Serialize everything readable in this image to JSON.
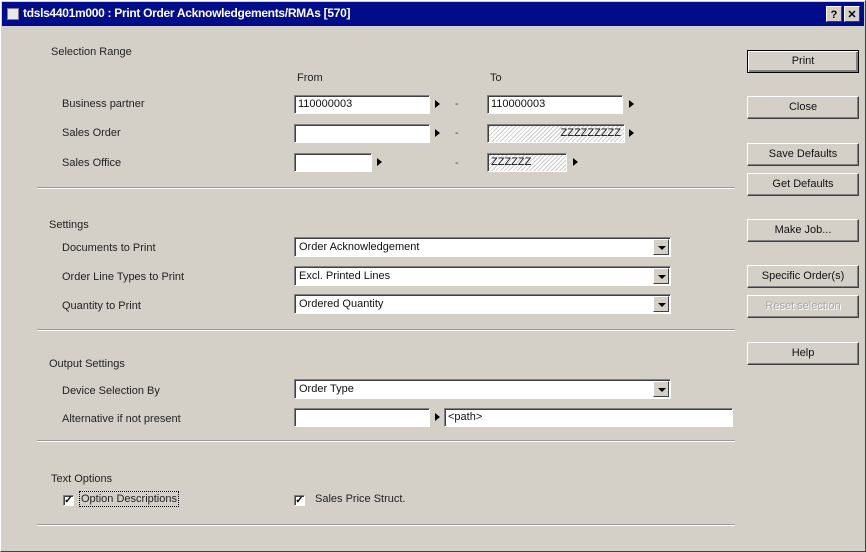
{
  "window": {
    "title": "tdsls4401m000 : Print Order Acknowledgements/RMAs [570]",
    "help_button": "?",
    "close_button": "✕"
  },
  "selection_range": {
    "title": "Selection Range",
    "from_label": "From",
    "to_label": "To",
    "rows": [
      {
        "label": "Business partner",
        "from_value": "110000003",
        "to_value": "110000003"
      },
      {
        "label": "Sales Order",
        "from_value": "",
        "to_value": "ZZZZZZZZZ"
      },
      {
        "label": "Sales Office",
        "from_value": "",
        "to_value": "ZZZZZZ"
      }
    ],
    "dash": "-"
  },
  "settings": {
    "title": "Settings",
    "documents_label": "Documents to Print",
    "documents_value": "Order Acknowledgement",
    "line_types_label": "Order Line Types to Print",
    "line_types_value": "Excl. Printed Lines",
    "quantity_label": "Quantity to Print",
    "quantity_value": "Ordered Quantity"
  },
  "output": {
    "title": "Output Settings",
    "device_label": "Device Selection By",
    "device_value": "Order Type",
    "alternative_label": "Alternative if not present",
    "alternative_value": "",
    "path_value": "<path>"
  },
  "text_options": {
    "title": "Text Options",
    "option_descriptions_label": "Option Descriptions",
    "option_descriptions_checked": true,
    "sales_price_label": "Sales Price Struct.",
    "sales_price_checked": true,
    "check_mark": "✓"
  },
  "buttons": {
    "print": "Print",
    "close": "Close",
    "save_defaults": "Save Defaults",
    "get_defaults": "Get Defaults",
    "make_job": "Make Job...",
    "specific_orders": "Specific Order(s)",
    "reset_selection": "Reset selection",
    "help": "Help"
  }
}
